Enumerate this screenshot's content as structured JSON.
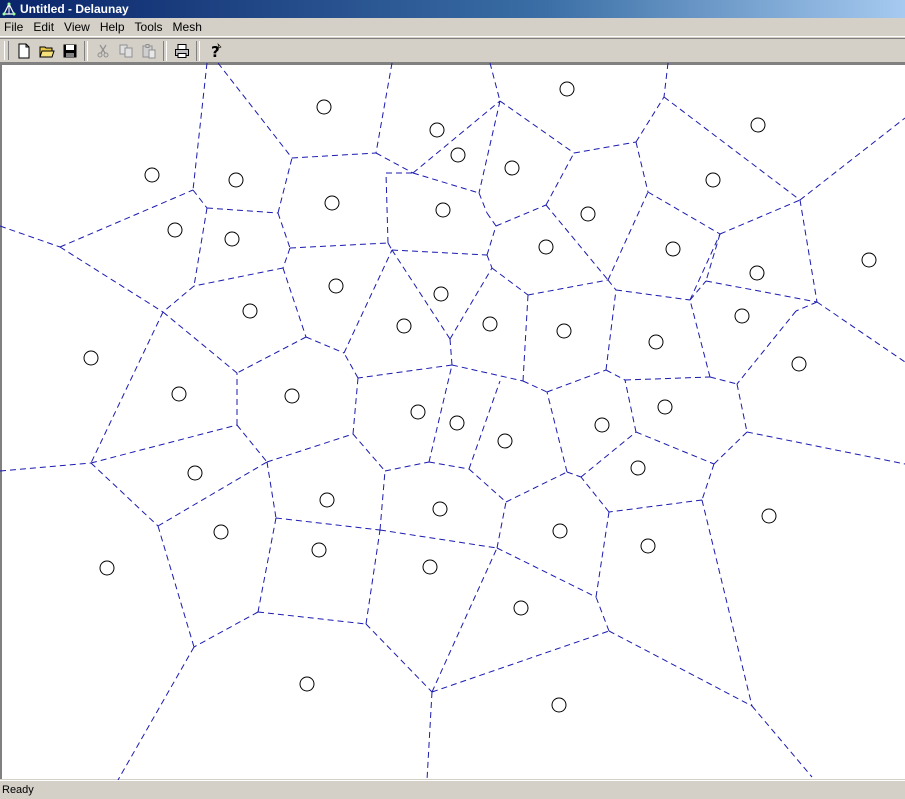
{
  "window": {
    "title": "Untitled - Delaunay",
    "icon": "delaunay-app-icon"
  },
  "menu": {
    "items": [
      {
        "label": "File"
      },
      {
        "label": "Edit"
      },
      {
        "label": "View"
      },
      {
        "label": "Help"
      },
      {
        "label": "Tools"
      },
      {
        "label": "Mesh"
      }
    ]
  },
  "toolbar": {
    "buttons": [
      {
        "icon": "new-document-icon",
        "enabled": true
      },
      {
        "icon": "open-folder-icon",
        "enabled": true
      },
      {
        "icon": "save-disk-icon",
        "enabled": true
      },
      {
        "icon": "cut-scissors-icon",
        "enabled": false
      },
      {
        "icon": "copy-icon",
        "enabled": false
      },
      {
        "icon": "paste-icon",
        "enabled": false
      },
      {
        "icon": "print-icon",
        "enabled": true
      },
      {
        "icon": "help-question-icon",
        "enabled": true
      }
    ]
  },
  "colors": {
    "edge": "#1a1ab0",
    "site": "#000000",
    "canvas": "#ffffff"
  },
  "status": {
    "text": "Ready"
  }
}
